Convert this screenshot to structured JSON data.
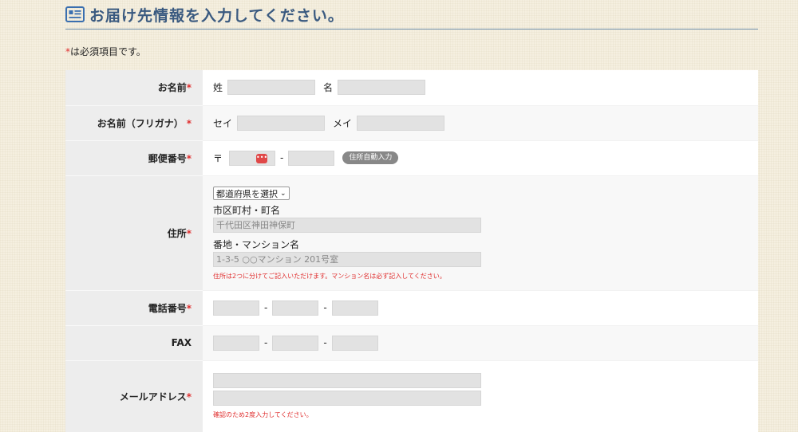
{
  "header": {
    "title": "お届け先情報を入力してください。",
    "icon": "form-card-icon"
  },
  "required_note": {
    "star": "*",
    "text": "は必須項目です。"
  },
  "colors": {
    "accent": "#3a5a80",
    "required": "#e03030"
  },
  "rows": {
    "name": {
      "label": "お名前",
      "star": "*",
      "last_label": "姓",
      "first_label": "名",
      "last_value": "",
      "first_value": ""
    },
    "kana": {
      "label": "お名前（フリガナ）",
      "star": "*",
      "last_label": "セイ",
      "first_label": "メイ",
      "last_value": "",
      "first_value": ""
    },
    "zip": {
      "label": "郵便番号",
      "star": "*",
      "mark": "〒",
      "dash": "-",
      "autofill_icon": "•••",
      "autofill_button": "住所自動入力"
    },
    "address": {
      "label": "住所",
      "star": "*",
      "prefecture_selected": "都道府県を選択",
      "city_label": "市区町村・町名",
      "city_placeholder": "千代田区神田神保町",
      "street_label": "番地・マンション名",
      "street_placeholder": "1-3-5 ○○マンション 201号室",
      "note": "住所は2つに分けてご記入いただけます。マンション名は必ず記入してください。"
    },
    "phone": {
      "label": "電話番号",
      "star": "*",
      "dash": "-"
    },
    "fax": {
      "label": "FAX",
      "dash": "-"
    },
    "email": {
      "label": "メールアドレス",
      "star": "*",
      "note": "確認のため2度入力してください。"
    }
  }
}
